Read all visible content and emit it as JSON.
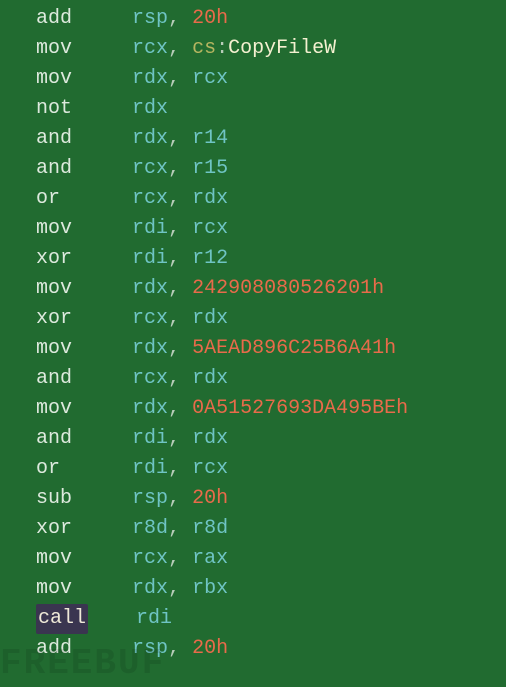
{
  "watermark": "FREEBUF",
  "lines": [
    {
      "parts": [
        {
          "t": "ind",
          "v": "   "
        },
        {
          "t": "mn",
          "v": "add"
        },
        {
          "t": "ind",
          "v": "     "
        },
        {
          "t": "reg",
          "v": "rsp"
        },
        {
          "t": "ind",
          "v": ", "
        },
        {
          "t": "num",
          "v": "20h"
        }
      ]
    },
    {
      "parts": [
        {
          "t": "ind",
          "v": "   "
        },
        {
          "t": "mn",
          "v": "mov"
        },
        {
          "t": "ind",
          "v": "     "
        },
        {
          "t": "reg",
          "v": "rcx"
        },
        {
          "t": "ind",
          "v": ", "
        },
        {
          "t": "seg",
          "v": "cs"
        },
        {
          "t": "ind",
          "v": ":"
        },
        {
          "t": "sym",
          "v": "CopyFileW"
        }
      ]
    },
    {
      "parts": [
        {
          "t": "ind",
          "v": "   "
        },
        {
          "t": "mn",
          "v": "mov"
        },
        {
          "t": "ind",
          "v": "     "
        },
        {
          "t": "reg",
          "v": "rdx"
        },
        {
          "t": "ind",
          "v": ", "
        },
        {
          "t": "reg",
          "v": "rcx"
        }
      ]
    },
    {
      "parts": [
        {
          "t": "ind",
          "v": "   "
        },
        {
          "t": "mn",
          "v": "not"
        },
        {
          "t": "ind",
          "v": "     "
        },
        {
          "t": "reg",
          "v": "rdx"
        }
      ]
    },
    {
      "parts": [
        {
          "t": "ind",
          "v": "   "
        },
        {
          "t": "mn",
          "v": "and"
        },
        {
          "t": "ind",
          "v": "     "
        },
        {
          "t": "reg",
          "v": "rdx"
        },
        {
          "t": "ind",
          "v": ", "
        },
        {
          "t": "reg",
          "v": "r14"
        }
      ]
    },
    {
      "parts": [
        {
          "t": "ind",
          "v": "   "
        },
        {
          "t": "mn",
          "v": "and"
        },
        {
          "t": "ind",
          "v": "     "
        },
        {
          "t": "reg",
          "v": "rcx"
        },
        {
          "t": "ind",
          "v": ", "
        },
        {
          "t": "reg",
          "v": "r15"
        }
      ]
    },
    {
      "parts": [
        {
          "t": "ind",
          "v": "   "
        },
        {
          "t": "mn",
          "v": "or"
        },
        {
          "t": "ind",
          "v": "      "
        },
        {
          "t": "reg",
          "v": "rcx"
        },
        {
          "t": "ind",
          "v": ", "
        },
        {
          "t": "reg",
          "v": "rdx"
        }
      ]
    },
    {
      "parts": [
        {
          "t": "ind",
          "v": "   "
        },
        {
          "t": "mn",
          "v": "mov"
        },
        {
          "t": "ind",
          "v": "     "
        },
        {
          "t": "reg",
          "v": "rdi"
        },
        {
          "t": "ind",
          "v": ", "
        },
        {
          "t": "reg",
          "v": "rcx"
        }
      ]
    },
    {
      "parts": [
        {
          "t": "ind",
          "v": "   "
        },
        {
          "t": "mn",
          "v": "xor"
        },
        {
          "t": "ind",
          "v": "     "
        },
        {
          "t": "reg",
          "v": "rdi"
        },
        {
          "t": "ind",
          "v": ", "
        },
        {
          "t": "reg",
          "v": "r12"
        }
      ]
    },
    {
      "parts": [
        {
          "t": "ind",
          "v": "   "
        },
        {
          "t": "mn",
          "v": "mov"
        },
        {
          "t": "ind",
          "v": "     "
        },
        {
          "t": "reg",
          "v": "rdx"
        },
        {
          "t": "ind",
          "v": ", "
        },
        {
          "t": "num",
          "v": "242908080526201h"
        }
      ]
    },
    {
      "parts": [
        {
          "t": "ind",
          "v": "   "
        },
        {
          "t": "mn",
          "v": "xor"
        },
        {
          "t": "ind",
          "v": "     "
        },
        {
          "t": "reg",
          "v": "rcx"
        },
        {
          "t": "ind",
          "v": ", "
        },
        {
          "t": "reg",
          "v": "rdx"
        }
      ]
    },
    {
      "parts": [
        {
          "t": "ind",
          "v": "   "
        },
        {
          "t": "mn",
          "v": "mov"
        },
        {
          "t": "ind",
          "v": "     "
        },
        {
          "t": "reg",
          "v": "rdx"
        },
        {
          "t": "ind",
          "v": ", "
        },
        {
          "t": "num",
          "v": "5AEAD896C25B6A41h"
        }
      ]
    },
    {
      "parts": [
        {
          "t": "ind",
          "v": "   "
        },
        {
          "t": "mn",
          "v": "and"
        },
        {
          "t": "ind",
          "v": "     "
        },
        {
          "t": "reg",
          "v": "rcx"
        },
        {
          "t": "ind",
          "v": ", "
        },
        {
          "t": "reg",
          "v": "rdx"
        }
      ]
    },
    {
      "parts": [
        {
          "t": "ind",
          "v": "   "
        },
        {
          "t": "mn",
          "v": "mov"
        },
        {
          "t": "ind",
          "v": "     "
        },
        {
          "t": "reg",
          "v": "rdx"
        },
        {
          "t": "ind",
          "v": ", "
        },
        {
          "t": "num",
          "v": "0A51527693DA495BEh"
        }
      ]
    },
    {
      "parts": [
        {
          "t": "ind",
          "v": "   "
        },
        {
          "t": "mn",
          "v": "and"
        },
        {
          "t": "ind",
          "v": "     "
        },
        {
          "t": "reg",
          "v": "rdi"
        },
        {
          "t": "ind",
          "v": ", "
        },
        {
          "t": "reg",
          "v": "rdx"
        }
      ]
    },
    {
      "parts": [
        {
          "t": "ind",
          "v": "   "
        },
        {
          "t": "mn",
          "v": "or"
        },
        {
          "t": "ind",
          "v": "      "
        },
        {
          "t": "reg",
          "v": "rdi"
        },
        {
          "t": "ind",
          "v": ", "
        },
        {
          "t": "reg",
          "v": "rcx"
        }
      ]
    },
    {
      "parts": [
        {
          "t": "ind",
          "v": "   "
        },
        {
          "t": "mn",
          "v": "sub"
        },
        {
          "t": "ind",
          "v": "     "
        },
        {
          "t": "reg",
          "v": "rsp"
        },
        {
          "t": "ind",
          "v": ", "
        },
        {
          "t": "num",
          "v": "20h"
        }
      ]
    },
    {
      "parts": [
        {
          "t": "ind",
          "v": "   "
        },
        {
          "t": "mn",
          "v": "xor"
        },
        {
          "t": "ind",
          "v": "     "
        },
        {
          "t": "reg",
          "v": "r8d"
        },
        {
          "t": "ind",
          "v": ", "
        },
        {
          "t": "reg",
          "v": "r8d"
        }
      ]
    },
    {
      "parts": [
        {
          "t": "ind",
          "v": "   "
        },
        {
          "t": "mn",
          "v": "mov"
        },
        {
          "t": "ind",
          "v": "     "
        },
        {
          "t": "reg",
          "v": "rcx"
        },
        {
          "t": "ind",
          "v": ", "
        },
        {
          "t": "reg",
          "v": "rax"
        }
      ]
    },
    {
      "parts": [
        {
          "t": "ind",
          "v": "   "
        },
        {
          "t": "mn",
          "v": "mov"
        },
        {
          "t": "ind",
          "v": "     "
        },
        {
          "t": "reg",
          "v": "rdx"
        },
        {
          "t": "ind",
          "v": ", "
        },
        {
          "t": "reg",
          "v": "rbx"
        }
      ]
    },
    {
      "parts": [
        {
          "t": "ind",
          "v": "   "
        },
        {
          "t": "call",
          "v": "call"
        },
        {
          "t": "ind",
          "v": "    "
        },
        {
          "t": "reg",
          "v": "rdi"
        }
      ]
    },
    {
      "parts": [
        {
          "t": "ind",
          "v": "   "
        },
        {
          "t": "mn",
          "v": "add"
        },
        {
          "t": "ind",
          "v": "     "
        },
        {
          "t": "reg",
          "v": "rsp"
        },
        {
          "t": "ind",
          "v": ", "
        },
        {
          "t": "num",
          "v": "20h"
        }
      ]
    }
  ]
}
